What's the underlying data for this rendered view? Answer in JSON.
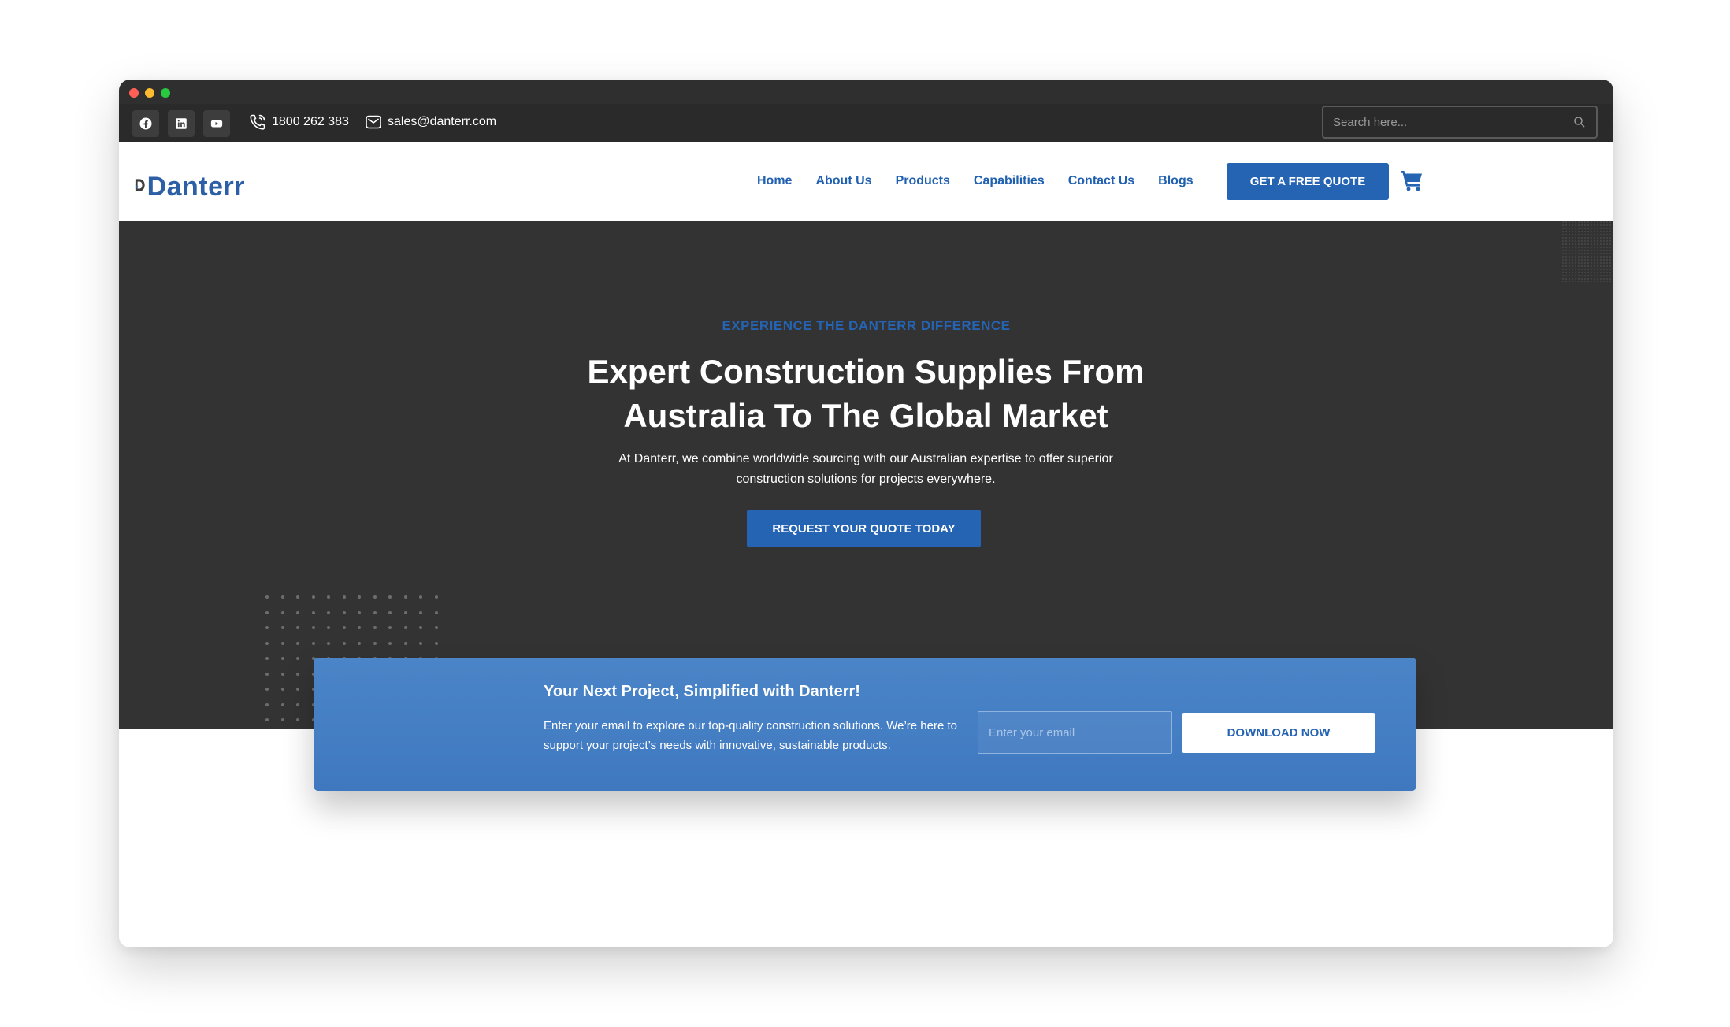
{
  "window": {
    "controls": [
      "close",
      "minimize",
      "maximize"
    ]
  },
  "topbar": {
    "social": [
      {
        "icon": "facebook-icon"
      },
      {
        "icon": "linkedin-icon"
      },
      {
        "icon": "youtube-icon"
      }
    ],
    "phone": "1800 262 383",
    "email": "sales@danterr.com",
    "search_placeholder": "Search here..."
  },
  "header": {
    "logo_text": "Danterr",
    "nav": [
      "Home",
      "About Us",
      "Products",
      "Capabilities",
      "Contact Us",
      "Blogs"
    ],
    "quote_button": "GET A FREE QUOTE",
    "brand_color": "#2563b3"
  },
  "hero": {
    "eyebrow": "EXPERIENCE THE DANTERR DIFFERENCE",
    "title_line1": "Expert Construction Supplies From",
    "title_line2": "Australia To The Global Market",
    "description": "At Danterr, we combine worldwide sourcing with our Australian expertise to offer superior construction solutions for projects everywhere.",
    "cta": "REQUEST YOUR QUOTE TODAY",
    "background": "#333333"
  },
  "newsletter": {
    "title": "Your Next Project, Simplified with Danterr!",
    "description": "Enter your email to explore our top-quality construction solutions. We’re here to support your project’s needs with innovative, sustainable products.",
    "email_placeholder": "Enter your email",
    "button": "DOWNLOAD NOW"
  }
}
